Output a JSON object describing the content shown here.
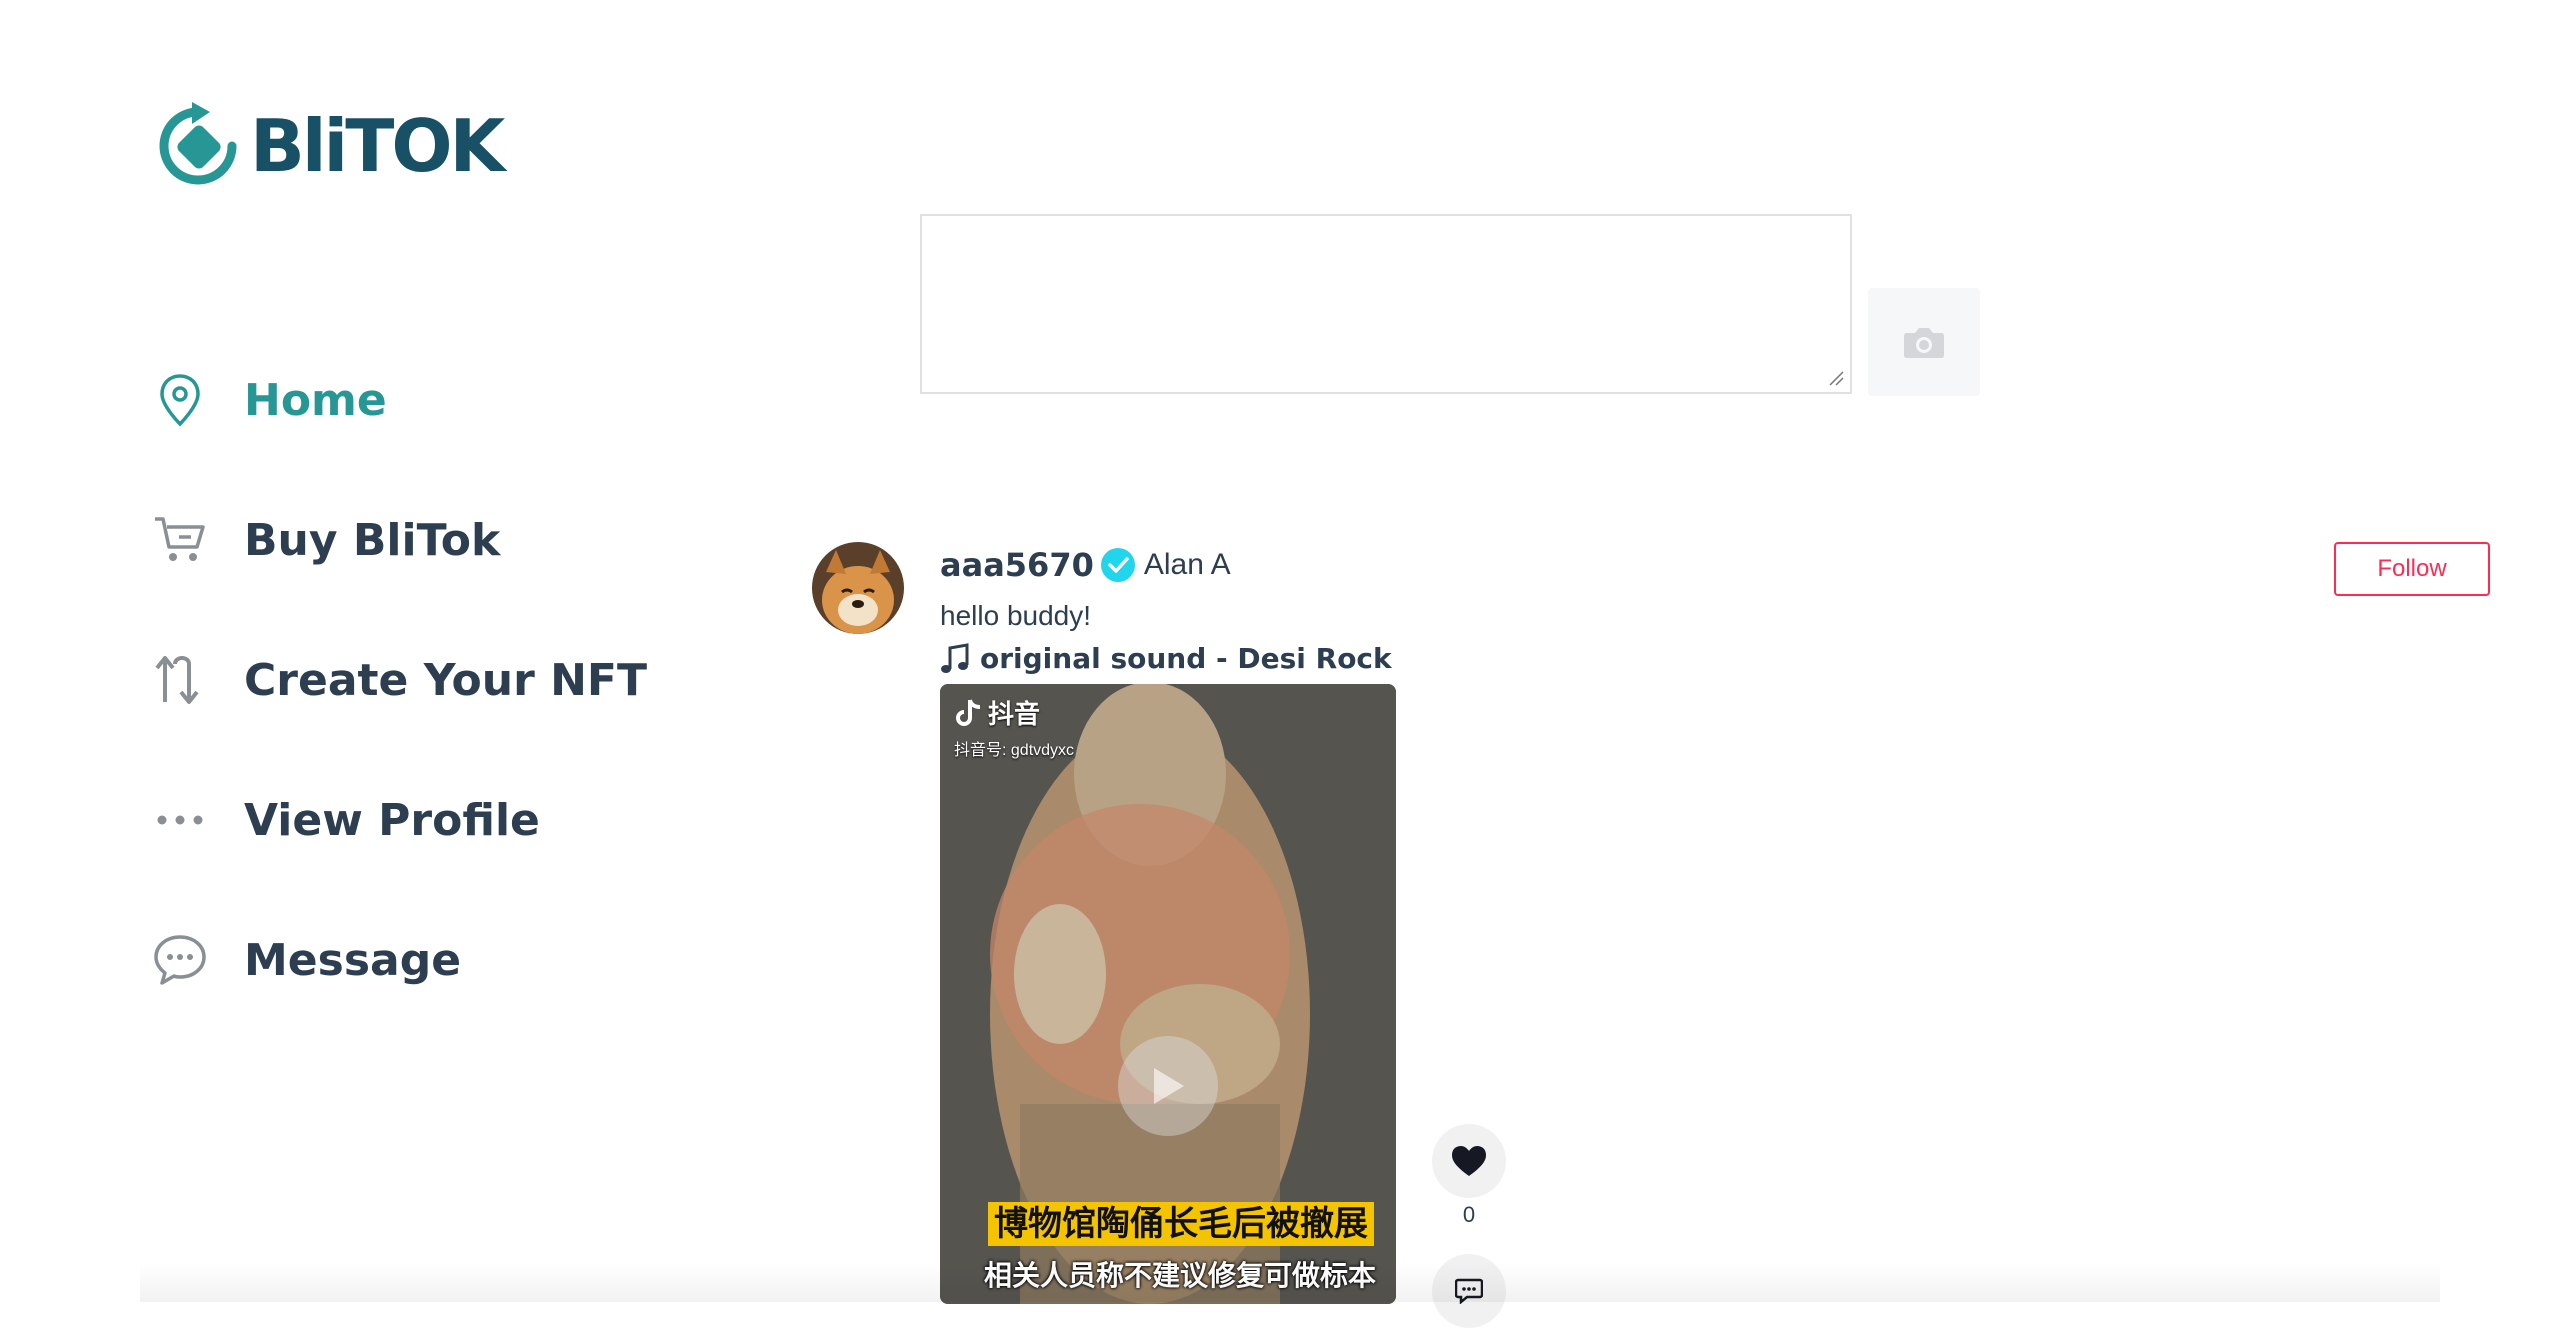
{
  "brand": {
    "name": "BliTOK",
    "color": "#185166",
    "accent": "#279796"
  },
  "nav": {
    "items": [
      {
        "label": "Home",
        "icon": "map-pin-icon",
        "active": true
      },
      {
        "label": "Buy BliTok",
        "icon": "cart-icon",
        "active": false
      },
      {
        "label": "Create Your NFT",
        "icon": "swap-arrows-icon",
        "active": false
      },
      {
        "label": "View Profile",
        "icon": "more-dots-icon",
        "active": false
      },
      {
        "label": "Message",
        "icon": "chat-bubble-icon",
        "active": false
      }
    ]
  },
  "composer": {
    "placeholder": "",
    "value": "",
    "camera_icon": "camera-icon"
  },
  "post": {
    "username": "aaa5670",
    "verified": true,
    "full_name": "Alan A",
    "caption": "hello buddy!",
    "sound": "original sound - Desi Rock",
    "follow_label": "Follow",
    "follow_color": "#fe2c55",
    "video": {
      "watermark_brand": "抖音",
      "watermark_id": "抖音号: gdtvdyxc",
      "subtitle_line1": "博物馆陶俑长毛后被撤展",
      "subtitle_line2": "相关人员称不建议修复可做标本"
    },
    "likes": "0"
  }
}
